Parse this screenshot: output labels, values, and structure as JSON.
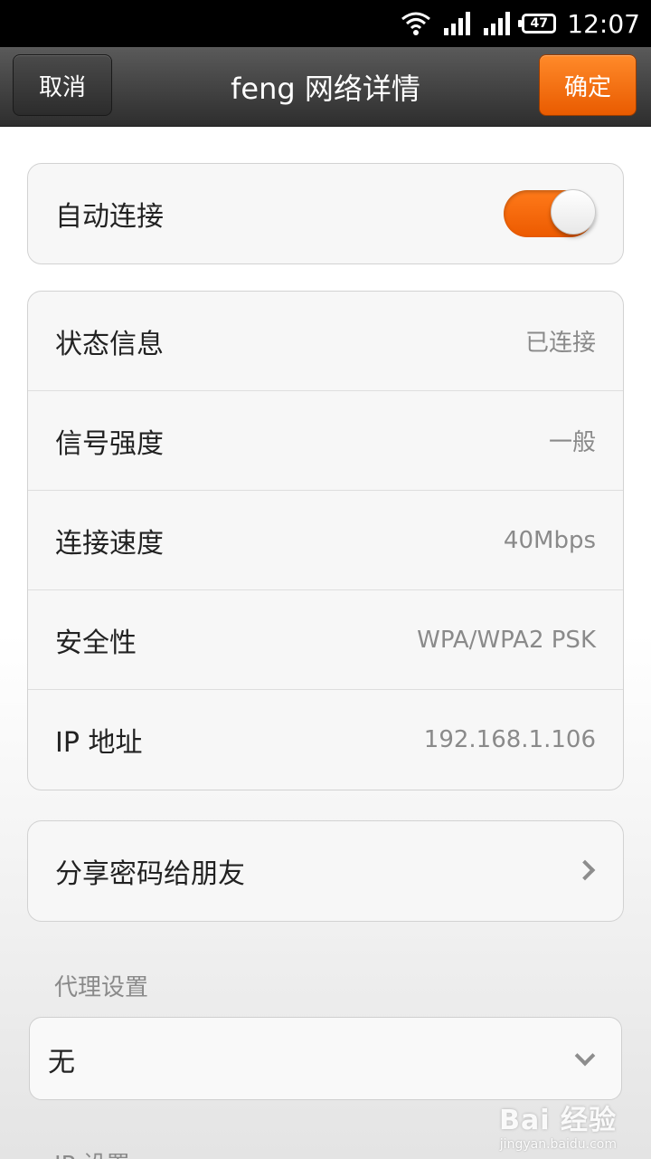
{
  "status_bar": {
    "battery": "47",
    "time": "12:07"
  },
  "header": {
    "cancel_label": "取消",
    "title": "feng 网络详情",
    "ok_label": "确定"
  },
  "auto_connect": {
    "label": "自动连接",
    "enabled": true
  },
  "details": [
    {
      "label": "状态信息",
      "value": "已连接"
    },
    {
      "label": "信号强度",
      "value": "一般"
    },
    {
      "label": "连接速度",
      "value": "40Mbps"
    },
    {
      "label": "安全性",
      "value": "WPA/WPA2 PSK"
    },
    {
      "label": "IP 地址",
      "value": "192.168.1.106"
    }
  ],
  "share": {
    "label": "分享密码给朋友"
  },
  "proxy": {
    "section_label": "代理设置",
    "selected": "无"
  },
  "ip_settings": {
    "section_label": "IP 设置"
  },
  "watermark": {
    "main": "Bai 经验",
    "sub": "jingyan.baidu.com"
  },
  "colors": {
    "accent": "#ee6100",
    "header_bg": "#3a3a3a",
    "card_bg": "#f7f7f7"
  }
}
